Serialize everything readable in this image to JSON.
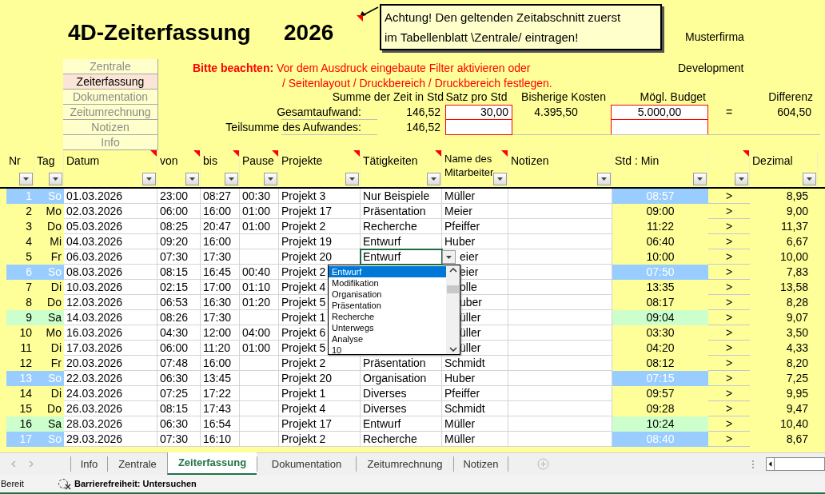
{
  "title": "4D-Zeiterfassung",
  "year": "2026",
  "company": "Musterfirma",
  "department": "Development",
  "comment_box": {
    "lines": [
      "Achtung! Den geltenden Zeitabschnitt zuerst",
      "im Tabellenblatt \\Zentrale/ eintragen!"
    ]
  },
  "nav": [
    {
      "label": "Zentrale",
      "selected": false
    },
    {
      "label": "Zeiterfassung",
      "selected": true
    },
    {
      "label": "Dokumentation",
      "selected": false
    },
    {
      "label": "Zeitumrechnung",
      "selected": false
    },
    {
      "label": "Notizen",
      "selected": false
    },
    {
      "label": "Info",
      "selected": false
    }
  ],
  "notice": [
    "**Bitte beachten:** Vor dem Ausdruck eingebaute Filter aktivieren oder",
    "/ Seitenlayout / Druckbereich / Druckbereich festlegen."
  ],
  "summary": {
    "sum_label": "Summe der Zeit in Std",
    "rate_label": "Satz pro Std",
    "cost_label": "Bisherige Kosten",
    "budget_label": "Mögl. Budget",
    "diff_label": "Differenz",
    "total_label": "Gesamtaufwand:",
    "total_hours": "146,52",
    "rate": "30,00",
    "cost": "4.395,50",
    "budget": "5.000,00",
    "equals": "=",
    "difference": "604,50",
    "subtotal_label": "Teilsumme des Aufwandes:",
    "subtotal_hours": "146,52"
  },
  "columns": [
    {
      "label": "Nr",
      "comment": false
    },
    {
      "label": "Tag",
      "comment": false
    },
    {
      "label": "Datum",
      "comment": true
    },
    {
      "label": "von",
      "comment": true
    },
    {
      "label": "bis",
      "comment": true
    },
    {
      "label": "Pause",
      "comment": true
    },
    {
      "label": "Projekte",
      "comment": true
    },
    {
      "label": "Tätigkeiten",
      "comment": true
    },
    {
      "label": "Name des Mitarbeiter",
      "comment": true
    },
    {
      "label": "Notizen",
      "comment": false
    },
    {
      "label": "Std : Min",
      "comment": false
    },
    {
      "comment": true
    },
    {
      "label": "Dezimal",
      "comment": false
    }
  ],
  "rows": [
    {
      "nr": "1",
      "tag": "So",
      "kind": "sunday",
      "datum": "01.03.2026",
      "von": "23:00",
      "bis": "08:27",
      "pause": "00:30",
      "projekt": "Projekt 3",
      "taetigkeit": "Nur Beispiele",
      "name": "Müller",
      "std_min": "08:57",
      "arrow": ">",
      "dezimal": "8,95"
    },
    {
      "nr": "2",
      "tag": "Mo",
      "kind": "weekday",
      "datum": "02.03.2026",
      "von": "06:00",
      "bis": "16:00",
      "pause": "01:00",
      "projekt": "Projekt 17",
      "taetigkeit": "Präsentation",
      "name": "Meier",
      "std_min": "09:00",
      "arrow": ">",
      "dezimal": "9,00"
    },
    {
      "nr": "3",
      "tag": "Do",
      "kind": "weekday",
      "datum": "05.03.2026",
      "von": "08:25",
      "bis": "20:47",
      "pause": "01:00",
      "projekt": "Projekt 2",
      "taetigkeit": "Recherche",
      "name": "Pfeiffer",
      "std_min": "11:22",
      "arrow": ">",
      "dezimal": "11,37"
    },
    {
      "nr": "4",
      "tag": "Mi",
      "kind": "weekday",
      "datum": "04.03.2026",
      "von": "09:20",
      "bis": "16:00",
      "projekt": "Projekt 19",
      "taetigkeit": "Entwurf",
      "name": "Huber",
      "std_min": "06:40",
      "arrow": ">",
      "dezimal": "6,67"
    },
    {
      "nr": "5",
      "tag": "Fr",
      "kind": "weekday",
      "datum": "06.03.2026",
      "von": "07:30",
      "bis": "17:30",
      "projekt": "Projekt 20",
      "taetigkeit": "Entwurf",
      "name": "eier",
      "std_min": "10:00",
      "arrow": ">",
      "dezimal": "10,00",
      "dropdown": {
        "options": [
          {
            "label": "Entwurf",
            "selected": true
          },
          {
            "label": "Modifikation",
            "selected": false
          },
          {
            "label": "Organisation",
            "selected": false
          },
          {
            "label": "Präsentation",
            "selected": false
          },
          {
            "label": "Recherche",
            "selected": false
          },
          {
            "label": "Unterwegs",
            "selected": false
          },
          {
            "label": "Analyse",
            "selected": false
          },
          {
            "label": "10",
            "selected": false
          }
        ]
      }
    },
    {
      "nr": "6",
      "tag": "So",
      "kind": "sunday",
      "datum": "08.03.2026",
      "von": "08:15",
      "bis": "16:45",
      "pause": "00:40",
      "projekt": "Projekt 2",
      "name": "eier",
      "std_min": "07:50",
      "arrow": ">",
      "dezimal": "7,83"
    },
    {
      "nr": "7",
      "tag": "Di",
      "kind": "weekday",
      "datum": "10.03.2026",
      "von": "02:15",
      "bis": "17:00",
      "pause": "01:10",
      "projekt": "Projekt 4",
      "name": "olle",
      "std_min": "13:35",
      "arrow": ">",
      "dezimal": "13,58"
    },
    {
      "nr": "8",
      "tag": "Do",
      "kind": "weekday",
      "datum": "12.03.2026",
      "von": "06:53",
      "bis": "16:30",
      "pause": "01:20",
      "projekt": "Projekt 5",
      "name": "uber",
      "std_min": "08:17",
      "arrow": ">",
      "dezimal": "8,28"
    },
    {
      "nr": "9",
      "tag": "Sa",
      "kind": "saturday",
      "datum": "14.03.2026",
      "von": "08:26",
      "bis": "17:30",
      "projekt": "Projekt 1",
      "name": "üller",
      "std_min": "09:04",
      "arrow": ">",
      "dezimal": "9,07"
    },
    {
      "nr": "10",
      "tag": "Mo",
      "kind": "weekday",
      "datum": "16.03.2026",
      "von": "04:30",
      "bis": "12:00",
      "pause": "04:00",
      "projekt": "Projekt 6",
      "name": "üller",
      "std_min": "03:30",
      "arrow": ">",
      "dezimal": "3,50"
    },
    {
      "nr": "11",
      "tag": "Di",
      "kind": "weekday",
      "datum": "17.03.2026",
      "von": "06:00",
      "bis": "11:20",
      "pause": "01:00",
      "projekt": "Projekt 5",
      "name": "üller",
      "std_min": "04:20",
      "arrow": ">",
      "dezimal": "4,33"
    },
    {
      "nr": "12",
      "tag": "Fr",
      "kind": "weekday",
      "datum": "20.03.2026",
      "von": "07:48",
      "bis": "16:00",
      "projekt": "Projekt 2",
      "taetigkeit": "Präsentation",
      "name": "Schmidt",
      "std_min": "08:12",
      "arrow": ">",
      "dezimal": "8,20"
    },
    {
      "nr": "13",
      "tag": "So",
      "kind": "sunday",
      "datum": "22.03.2026",
      "von": "06:30",
      "bis": "13:45",
      "projekt": "Projekt 20",
      "taetigkeit": "Organisation",
      "name": "Huber",
      "std_min": "07:15",
      "arrow": ">",
      "dezimal": "7,25"
    },
    {
      "nr": "14",
      "tag": "Di",
      "kind": "weekday",
      "datum": "24.03.2026",
      "von": "07:25",
      "bis": "17:22",
      "projekt": "Projekt 1",
      "taetigkeit": "Diverses",
      "name": "Pfeiffer",
      "std_min": "09:57",
      "arrow": ">",
      "dezimal": "9,95"
    },
    {
      "nr": "15",
      "tag": "Do",
      "kind": "weekday",
      "datum": "26.03.2026",
      "von": "08:15",
      "bis": "17:43",
      "projekt": "Projekt 4",
      "taetigkeit": "Diverses",
      "name": "Schmidt",
      "std_min": "09:28",
      "arrow": ">",
      "dezimal": "9,47"
    },
    {
      "nr": "16",
      "tag": "Sa",
      "kind": "saturday",
      "datum": "28.03.2026",
      "von": "06:30",
      "bis": "16:54",
      "projekt": "Projekt 17",
      "taetigkeit": "Entwurf",
      "name": "Müller",
      "std_min": "10:24",
      "arrow": ">",
      "dezimal": "10,40"
    },
    {
      "nr": "17",
      "tag": "So",
      "kind": "sunday",
      "datum": "29.03.2026",
      "von": "07:30",
      "bis": "16:10",
      "projekt": "Projekt 2",
      "taetigkeit": "Recherche",
      "name": "Müller",
      "std_min": "08:40",
      "arrow": ">",
      "dezimal": "8,67"
    }
  ],
  "sheet_tabs": [
    {
      "label": "Info",
      "selected": false
    },
    {
      "label": "Zentrale",
      "selected": false
    },
    {
      "label": "Zeiterfassung",
      "selected": true
    },
    {
      "label": "Dokumentation",
      "selected": false
    },
    {
      "label": "Zeitumrechnung",
      "selected": false
    },
    {
      "label": "Notizen",
      "selected": false
    }
  ],
  "status": {
    "ready": "Bereit",
    "accessibility": "Barrierefreiheit: Untersuchen"
  }
}
